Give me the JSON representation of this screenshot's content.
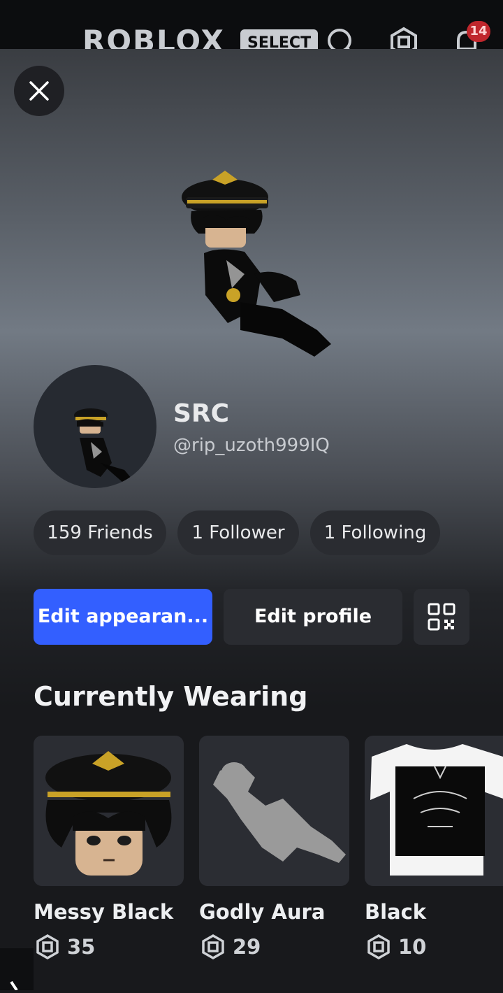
{
  "header": {
    "logo_text": "ROBLOX",
    "select_label": "SELECT",
    "notification_count": "14",
    "icons": [
      "search-icon",
      "robux-icon",
      "notification-icon"
    ]
  },
  "profile": {
    "display_name": "SRC",
    "username": "@rip_uzoth999IQ"
  },
  "stats": {
    "friends": "159 Friends",
    "followers": "1 Follower",
    "following": "1 Following"
  },
  "actions": {
    "edit_appearance": "Edit appearan...",
    "edit_profile": "Edit profile",
    "qr_icon": "qr-code-icon"
  },
  "wearing": {
    "title": "Currently Wearing",
    "items": [
      {
        "name": "Messy Black",
        "price": "35"
      },
      {
        "name": "Godly Aura",
        "price": "29"
      },
      {
        "name": "Black",
        "price": "10"
      }
    ]
  },
  "colors": {
    "primary": "#335fff",
    "background": "#18191c",
    "surface": "#2a2c31",
    "notification": "#c0272d"
  }
}
